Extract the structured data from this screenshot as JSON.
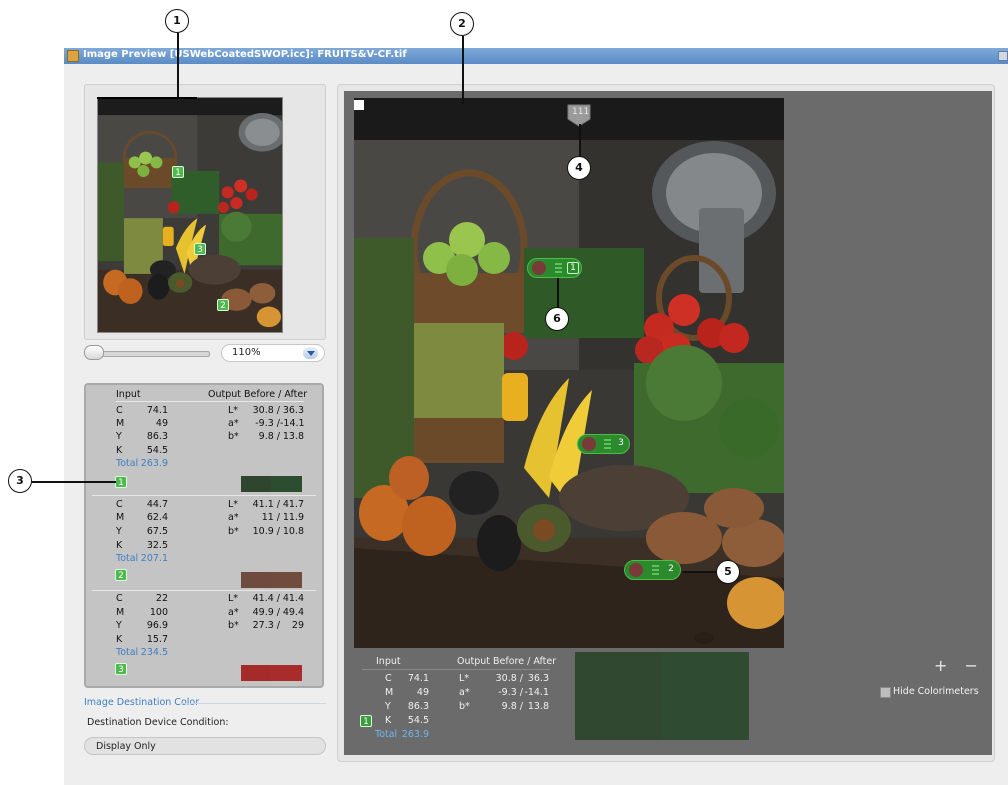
{
  "window": {
    "title": "Image Preview [USWebCoatedSWOP.icc]: FRUITS&V-CF.tif"
  },
  "zoom": {
    "value": "110%"
  },
  "left_panel": {
    "header": {
      "input": "Input",
      "output": "Output Before / After"
    },
    "entries": [
      {
        "id": "1",
        "C": "74.1",
        "M": "49",
        "Y": "86.3",
        "K": "54.5",
        "total_label": "Total",
        "total": "263.9",
        "L": "30.8 /",
        "L_after": "36.3",
        "a": "-9.3 /",
        "a_after": "-14.1",
        "b": "9.8 /",
        "b_after": "13.8",
        "before_color": "#2f4530",
        "after_color": "#2d4d30"
      },
      {
        "id": "2",
        "C": "44.7",
        "M": "62.4",
        "Y": "67.5",
        "K": "32.5",
        "total_label": "Total",
        "total": "207.1",
        "L": "41.1 /",
        "L_after": "41.7",
        "a": "11 /",
        "a_after": "11.9",
        "b": "10.9 /",
        "b_after": "10.8",
        "before_color": "#6f4a3e",
        "after_color": "#724b3f"
      },
      {
        "id": "3",
        "C": "22",
        "M": "100",
        "Y": "96.9",
        "K": "15.7",
        "total_label": "Total",
        "total": "234.5",
        "L": "41.4 /",
        "L_after": "41.4",
        "a": "49.9 /",
        "a_after": "49.4",
        "b": "27.3 /",
        "b_after": "29",
        "before_color": "#a52a2a",
        "after_color": "#a82c2c"
      }
    ],
    "labels": {
      "C": "C",
      "M": "M",
      "Y": "Y",
      "K": "K",
      "L": "L*",
      "a": "a*",
      "b": "b*"
    }
  },
  "destination": {
    "section_label": "Image Destination Color",
    "condition_label": "Destination Device Condition:",
    "condition_value": "Display Only"
  },
  "preview": {
    "top_tag": "111",
    "colorimeters": [
      "1",
      "3",
      "2"
    ]
  },
  "bottom_readout": {
    "header": {
      "input": "Input",
      "output": "Output Before / After"
    },
    "id": "1",
    "C": "74.1",
    "M": "49",
    "Y": "86.3",
    "K": "54.5",
    "total_label": "Total",
    "total": "263.9",
    "L": "30.8 /",
    "L_after": "36.3",
    "a": "-9.3 /",
    "a_after": "-14.1",
    "b": "9.8 /",
    "b_after": "13.8"
  },
  "controls": {
    "plus_minus": "+ −",
    "hide_colorimeters": "Hide Colorimeters"
  },
  "callouts": [
    "1",
    "2",
    "3",
    "4",
    "5",
    "6"
  ]
}
